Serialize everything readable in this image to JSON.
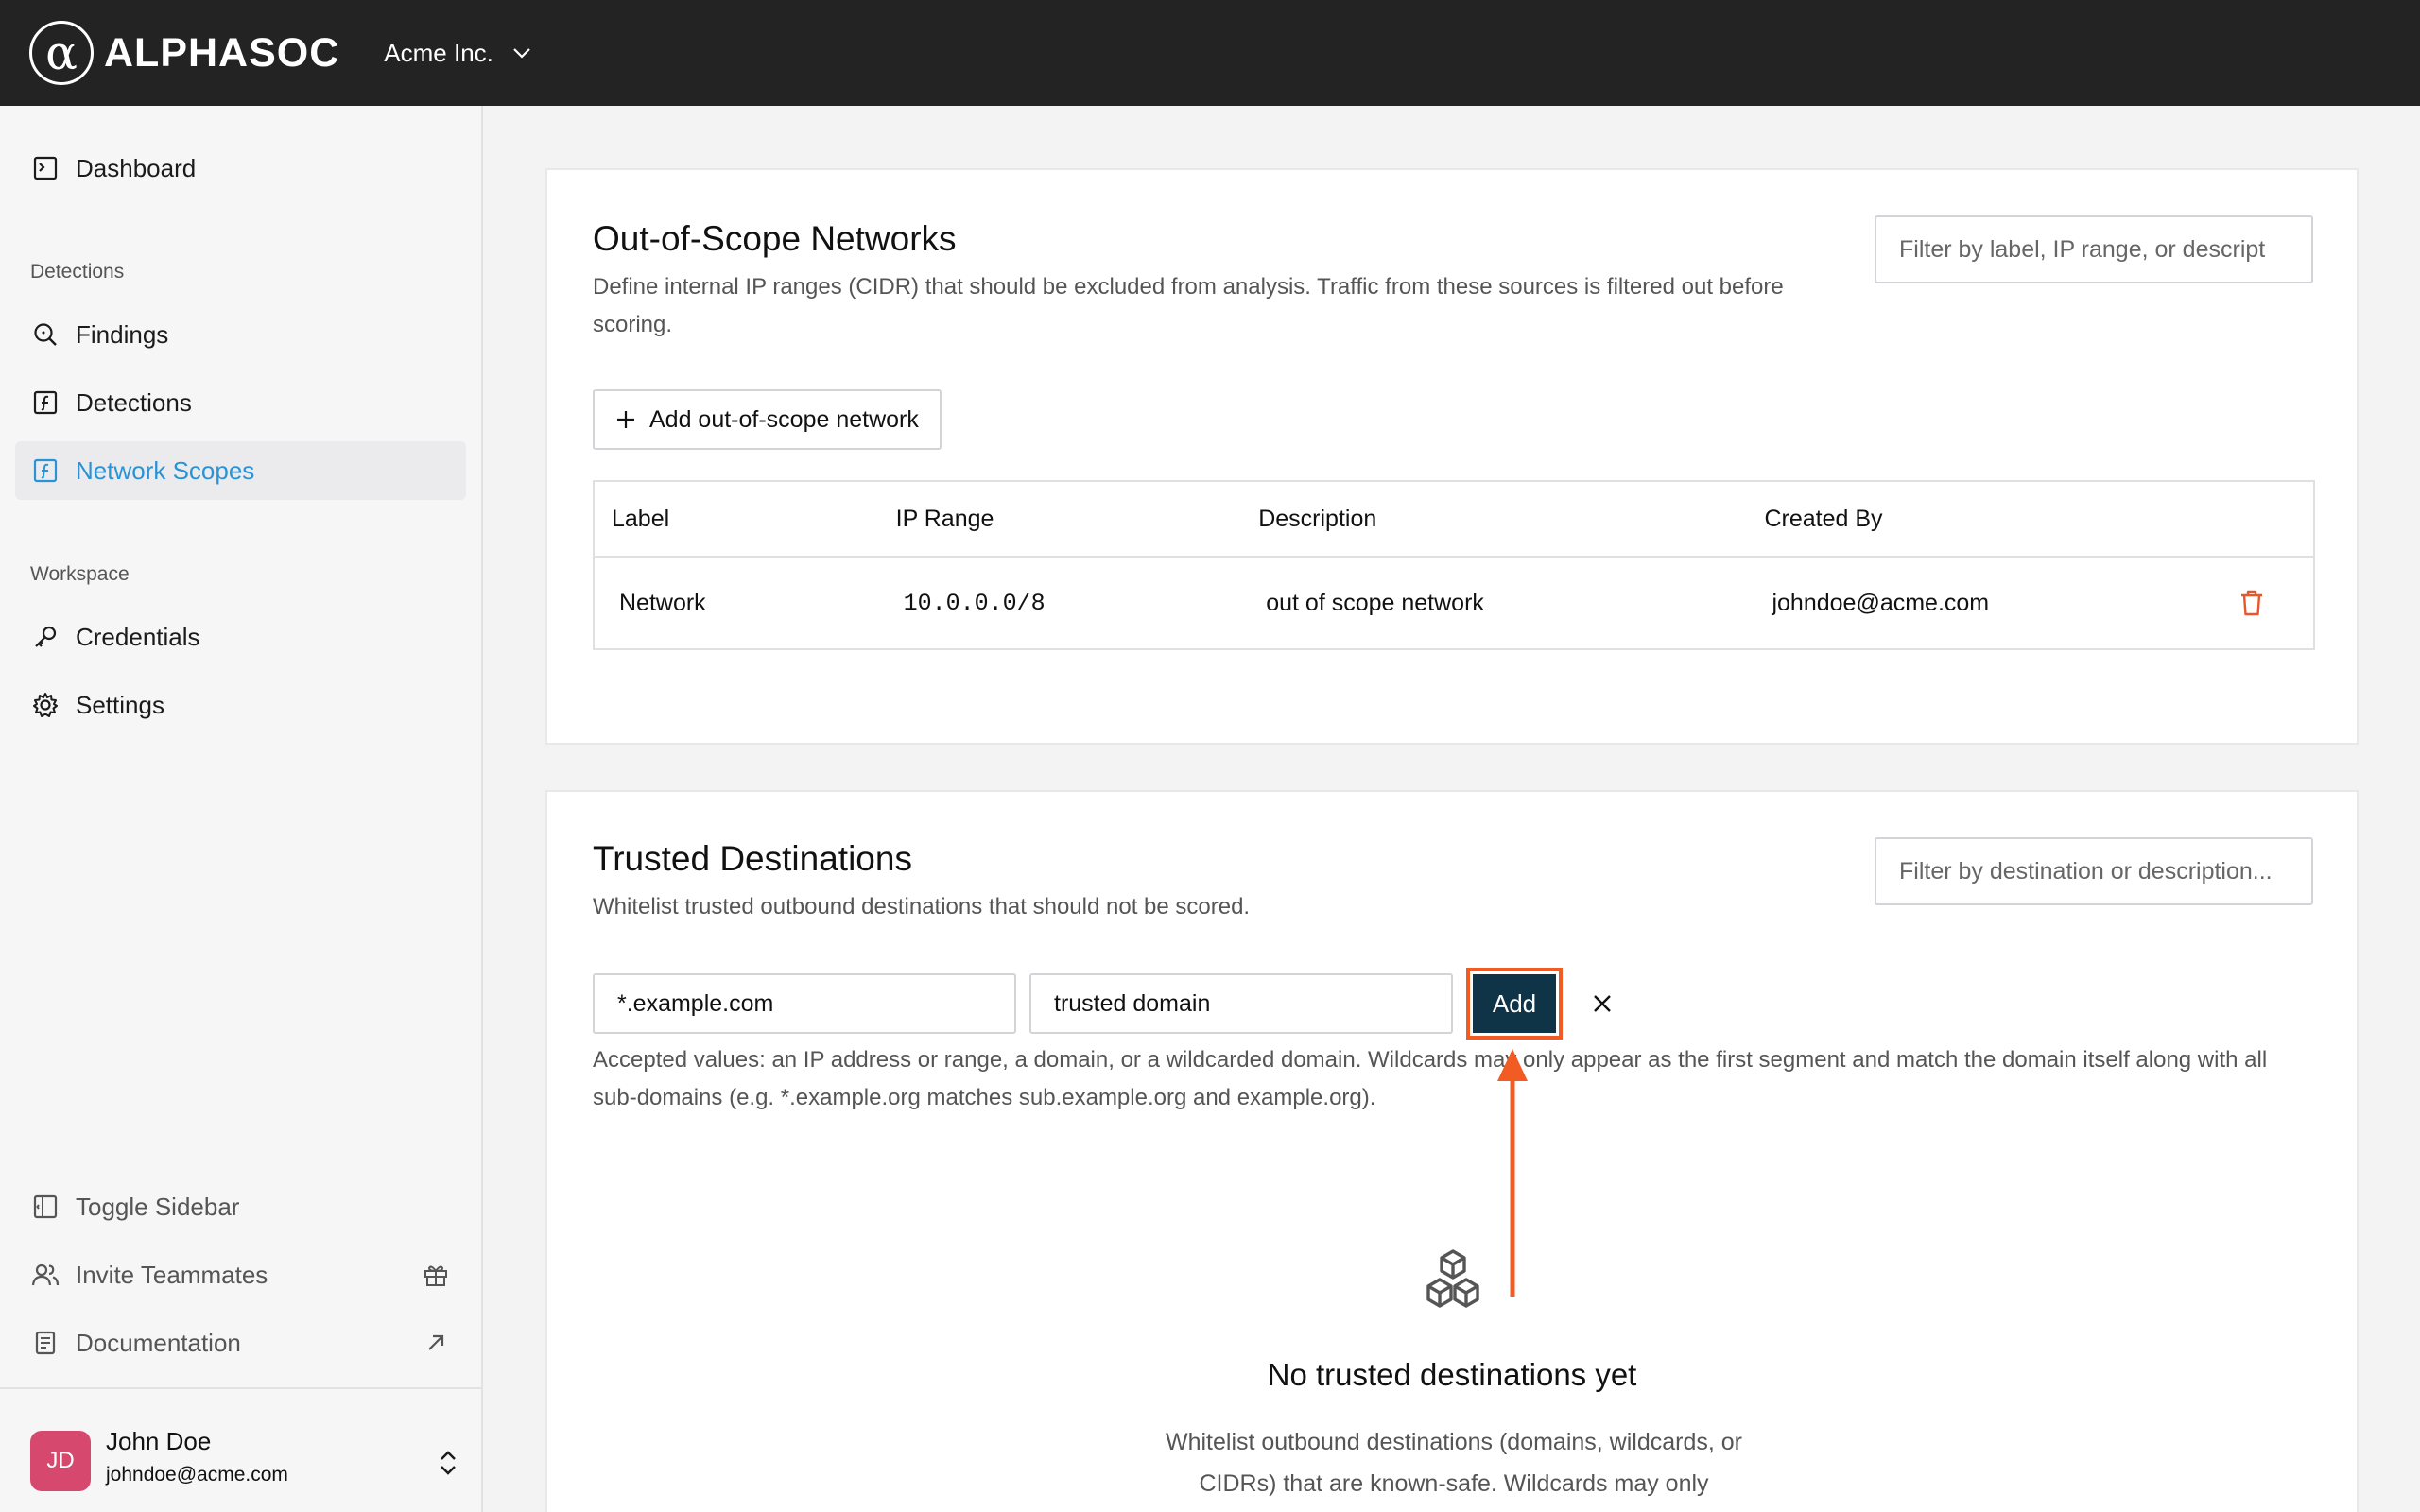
{
  "topbar": {
    "logo_text": "ALPHASOC",
    "logo_mark": "α",
    "org_name": "Acme Inc."
  },
  "sidebar": {
    "dashboard": "Dashboard",
    "detections_section": "Detections",
    "findings": "Findings",
    "detections": "Detections",
    "network_scopes": "Network Scopes",
    "workspace_section": "Workspace",
    "credentials": "Credentials",
    "settings": "Settings",
    "toggle_sidebar": "Toggle Sidebar",
    "invite_teammates": "Invite Teammates",
    "documentation": "Documentation",
    "user": {
      "initials": "JD",
      "name": "John Doe",
      "email": "johndoe@acme.com"
    }
  },
  "out_of_scope": {
    "title": "Out-of-Scope Networks",
    "description": "Define internal IP ranges (CIDR) that should be excluded from analysis. Traffic from these sources is filtered out before scoring.",
    "filter_placeholder": "Filter by label, IP range, or descript",
    "add_button": "Add out-of-scope network",
    "columns": [
      "Label",
      "IP Range",
      "Description",
      "Created By"
    ],
    "rows": [
      {
        "label": "Network",
        "ip_range": "10.0.0.0/8",
        "description": "out of scope network",
        "created_by": "johndoe@acme.com"
      }
    ]
  },
  "trusted_destinations": {
    "title": "Trusted Destinations",
    "description": "Whitelist trusted outbound destinations that should not be scored.",
    "filter_placeholder": "Filter by destination or description...",
    "destination_value": "*.example.com",
    "description_value": "trusted domain",
    "add_button": "Add",
    "hint": "Accepted values: an IP address or range, a domain, or a wildcarded domain. Wildcards may only appear as the first segment and match the domain itself along with all sub-domains (e.g. *.example.org matches sub.example.org and example.org).",
    "empty_title": "No trusted destinations yet",
    "empty_text": "Whitelist outbound destinations (domains, wildcards, or CIDRs) that are known-safe. Wildcards may only"
  },
  "colors": {
    "topbar": "#232323",
    "accent_active": "#2a93d5",
    "primary_button": "#0f3447",
    "annotation": "#f25c22",
    "danger": "#e8562a",
    "avatar": "#d7486e"
  }
}
